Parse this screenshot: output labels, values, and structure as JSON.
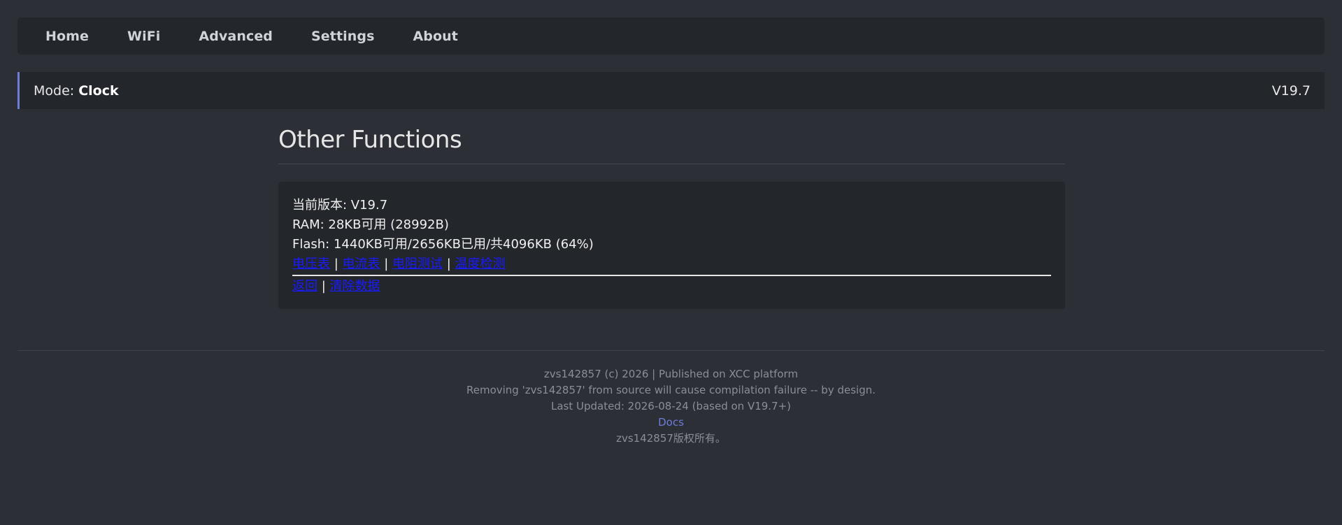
{
  "nav": {
    "items": [
      {
        "label": "Home"
      },
      {
        "label": "WiFi"
      },
      {
        "label": "Advanced"
      },
      {
        "label": "Settings"
      },
      {
        "label": "About"
      }
    ]
  },
  "mode_bar": {
    "mode_label": "Mode: ",
    "mode_value": "Clock",
    "version": "V19.7"
  },
  "page": {
    "title": "Other Functions"
  },
  "info": {
    "version_line": "当前版本: V19.7",
    "ram_line": "RAM: 28KB可用 (28992B)",
    "flash_line": "Flash: 1440KB可用/2656KB已用/共4096KB (64%)",
    "links_row1": [
      "电压表",
      "电流表",
      "电阻测试",
      "温度检测"
    ],
    "links_row2": [
      "返回",
      "清除数据"
    ],
    "separator": " | "
  },
  "footer": {
    "line1": "zvs142857 (c) 2026 | Published on XCC platform",
    "line2": "Removing 'zvs142857' from source will cause compilation failure -- by design.",
    "line3": "Last Updated: 2026-08-24 (based on V19.7+)",
    "docs_link": "Docs",
    "line5": "zvs142857版权所有。"
  }
}
